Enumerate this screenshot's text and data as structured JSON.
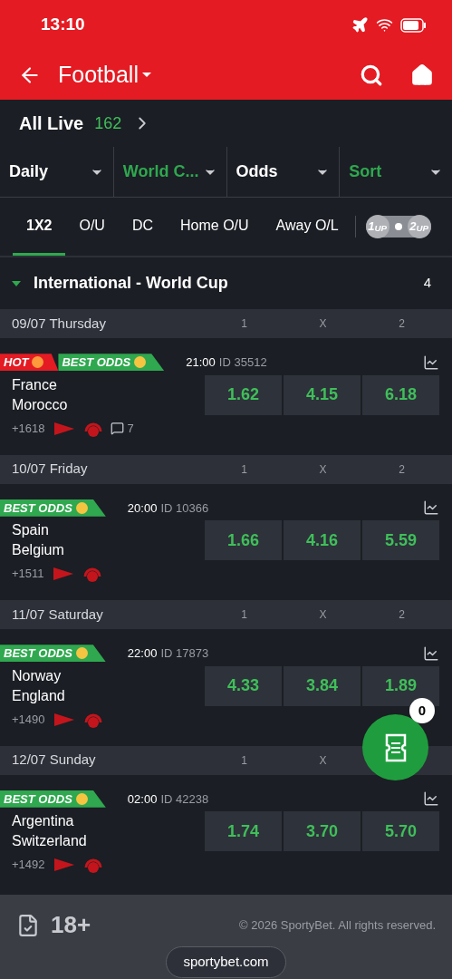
{
  "status_bar": {
    "time": "13:10"
  },
  "header": {
    "title": "Football"
  },
  "all_live": {
    "label": "All Live",
    "count": "162"
  },
  "filters": [
    {
      "label": "Daily",
      "selected": false
    },
    {
      "label": "World C...",
      "selected": true
    },
    {
      "label": "Odds",
      "selected": false
    },
    {
      "label": "Sort",
      "selected": true
    }
  ],
  "market_tabs": [
    {
      "label": "1X2",
      "selected": true
    },
    {
      "label": "O/U",
      "selected": false
    },
    {
      "label": "DC",
      "selected": false
    },
    {
      "label": "Home O/U",
      "selected": false
    },
    {
      "label": "Away O/L",
      "selected": false
    }
  ],
  "toggle": {
    "left": "1$_{UP}$",
    "right": "2$_{UP}$",
    "on": false
  },
  "league": {
    "name": "International - World Cup",
    "count": "4",
    "expanded": true
  },
  "days": [
    {
      "date": "09/07 Thursday",
      "headers": [
        "1",
        "X",
        "2"
      ],
      "matches": [
        {
          "badges": [
            {
              "kind": "hot",
              "label": "HOT"
            },
            {
              "kind": "best",
              "label": "BEST ODDS"
            }
          ],
          "time": "21:00",
          "id": "ID 35512",
          "home": "France",
          "away": "Morocco",
          "odds": [
            "1.62",
            "4.15",
            "6.18"
          ],
          "markets": "+1618",
          "comments": "7"
        }
      ]
    },
    {
      "date": "10/07 Friday",
      "headers": [
        "1",
        "X",
        "2"
      ],
      "matches": [
        {
          "badges": [
            {
              "kind": "best",
              "label": "BEST ODDS"
            }
          ],
          "time": "20:00",
          "id": "ID 10366",
          "home": "Spain",
          "away": "Belgium",
          "odds": [
            "1.66",
            "4.16",
            "5.59"
          ],
          "markets": "+1511"
        }
      ]
    },
    {
      "date": "11/07 Saturday",
      "headers": [
        "1",
        "X",
        "2"
      ],
      "matches": [
        {
          "badges": [
            {
              "kind": "best",
              "label": "BEST ODDS"
            }
          ],
          "time": "22:00",
          "id": "ID 17873",
          "home": "Norway",
          "away": "England",
          "odds": [
            "4.33",
            "3.84",
            "1.89"
          ],
          "markets": "+1490"
        }
      ]
    },
    {
      "date": "12/07 Sunday",
      "headers": [
        "1",
        "X"
      ],
      "matches": [
        {
          "badges": [
            {
              "kind": "best",
              "label": "BEST ODDS"
            }
          ],
          "time": "02:00",
          "id": "ID 42238",
          "home": "Argentina",
          "away": "Switzerland",
          "odds": [
            "1.74",
            "3.70",
            "5.70"
          ],
          "markets": "+1492"
        }
      ]
    }
  ],
  "betslip": {
    "count": "0"
  },
  "footer": {
    "age": "18+",
    "copyright": "© 2026 SportyBet. All rights reserved.",
    "site": "sportybet.com"
  }
}
